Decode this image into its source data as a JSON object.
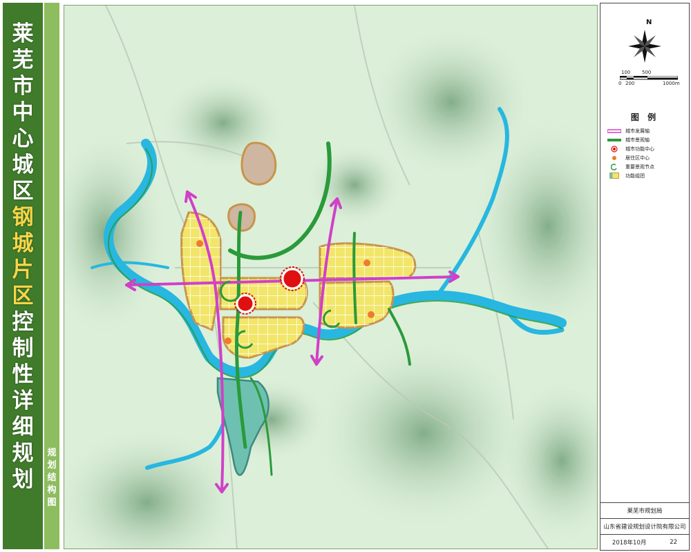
{
  "title_chars": [
    {
      "char": "莱",
      "highlight": false
    },
    {
      "char": "芜",
      "highlight": false
    },
    {
      "char": "市",
      "highlight": false
    },
    {
      "char": "中",
      "highlight": false
    },
    {
      "char": "心",
      "highlight": false
    },
    {
      "char": "城",
      "highlight": false
    },
    {
      "char": "区",
      "highlight": false
    },
    {
      "char": "钢",
      "highlight": true
    },
    {
      "char": "城",
      "highlight": true
    },
    {
      "char": "片",
      "highlight": true
    },
    {
      "char": "区",
      "highlight": true
    },
    {
      "char": "控",
      "highlight": false
    },
    {
      "char": "制",
      "highlight": false
    },
    {
      "char": "性",
      "highlight": false
    },
    {
      "char": "详",
      "highlight": false
    },
    {
      "char": "细",
      "highlight": false
    },
    {
      "char": "规",
      "highlight": false
    },
    {
      "char": "划",
      "highlight": false
    }
  ],
  "subtitle_chars": [
    "规",
    "划",
    "结",
    "构",
    "图"
  ],
  "compass": {
    "north_label": "N"
  },
  "scale": {
    "top_labels": [
      "100",
      "500"
    ],
    "bottom_labels": [
      "0",
      "200",
      "1000m"
    ]
  },
  "legend": {
    "title": "图 例",
    "items": [
      {
        "label": "城市发展轴",
        "symbol": "axis-development",
        "color": "#d040c8"
      },
      {
        "label": "城市景观轴",
        "symbol": "axis-landscape",
        "color": "#2a9a3a"
      },
      {
        "label": "城市功能中心",
        "symbol": "function-center",
        "color": "#e01010"
      },
      {
        "label": "居住区中心",
        "symbol": "residential-center",
        "color": "#f07a30"
      },
      {
        "label": "重要景观节点",
        "symbol": "landscape-node",
        "color": "#2a9a3a"
      },
      {
        "label": "功能组团",
        "symbol": "function-cluster",
        "color": "#f2e66a"
      }
    ]
  },
  "footer": {
    "bureau": "莱芜市规划局",
    "institute": "山东省建设规划设计院有限公司",
    "date": "2018年10月",
    "page": "22"
  },
  "colors": {
    "title_bar": "#3f7b2a",
    "title_highlight": "#f6d64a",
    "sub_bar": "#8dbd5f",
    "river": "#27b7e0",
    "dev_axis": "#d040c8",
    "landscape_axis": "#2a9a3a",
    "cluster": "#f2e66a",
    "cluster_border": "#c8944a"
  }
}
